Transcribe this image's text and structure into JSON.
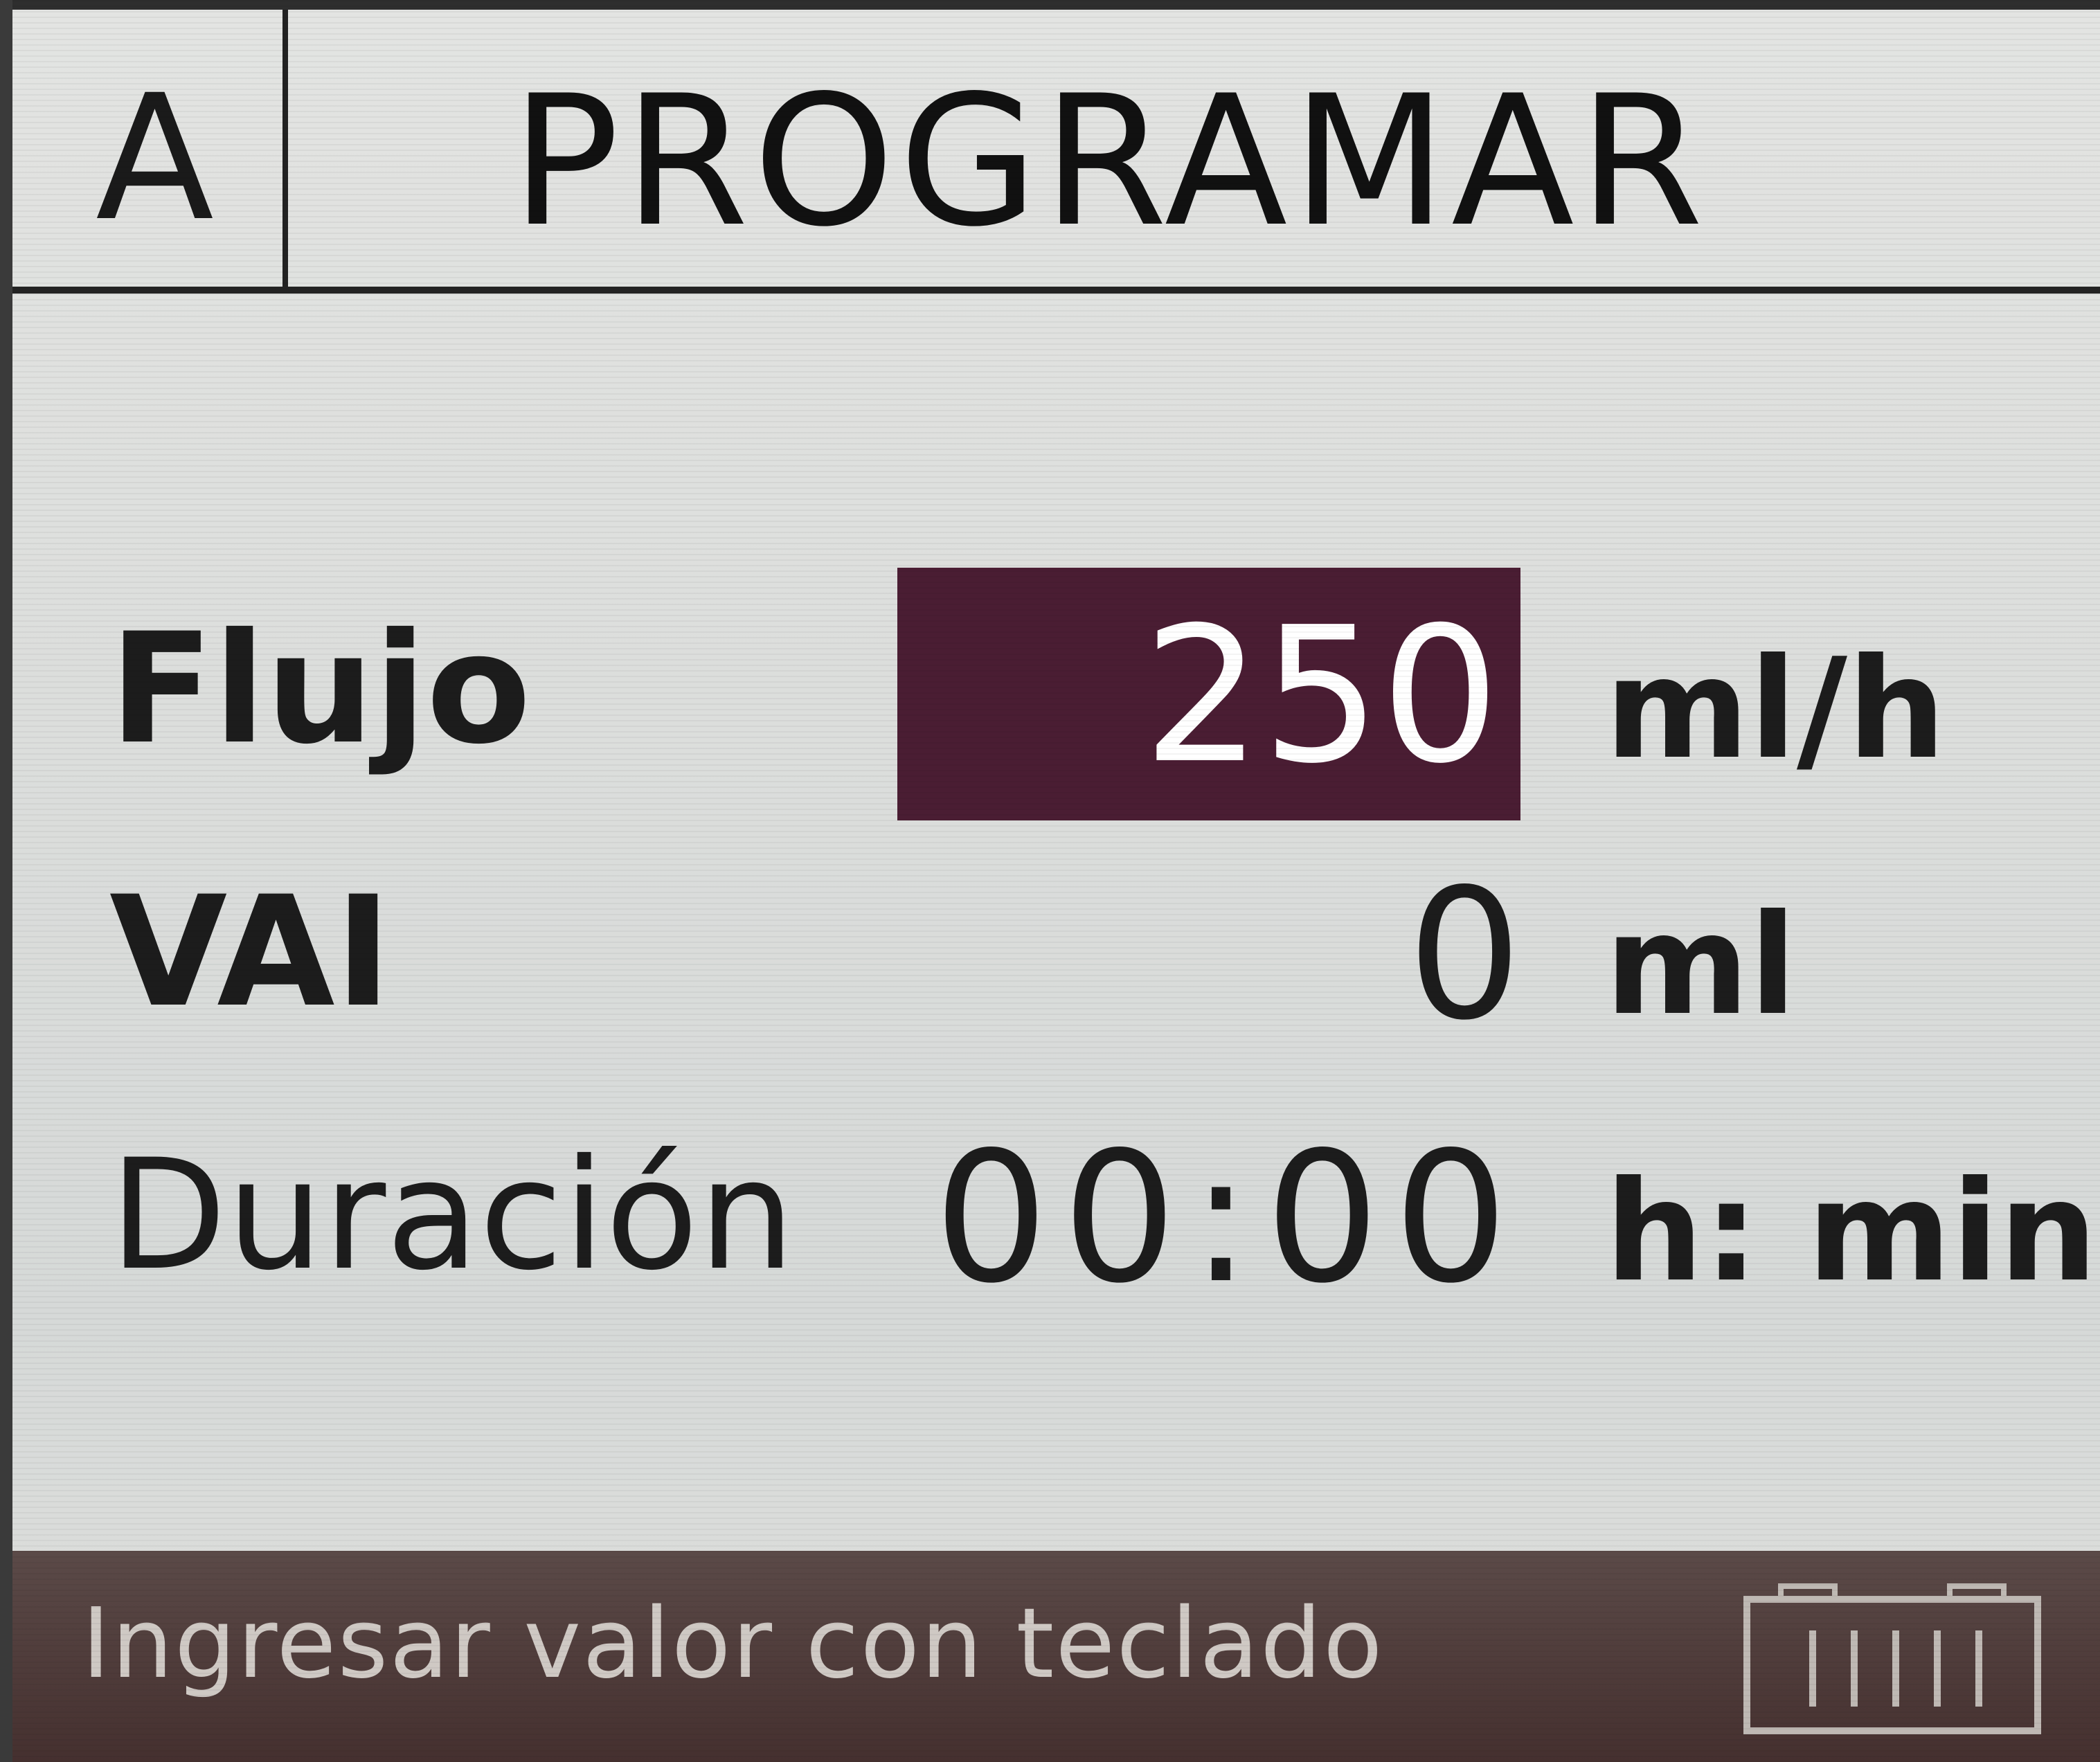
{
  "header": {
    "channel": "A",
    "title": "PROGRAMAR"
  },
  "rows": [
    {
      "label": "Flujo",
      "value": "250",
      "unit": "ml/h",
      "selected": true
    },
    {
      "label": "VAI",
      "value": "0",
      "unit": "ml",
      "selected": false
    },
    {
      "label": "Duración",
      "value": "00:00",
      "unit": "h: min",
      "selected": false
    }
  ],
  "footer": {
    "hint": "Ingresar valor con teclado",
    "battery_icon": "battery-icon",
    "battery_level": 1.0
  },
  "colors": {
    "highlight": "#4a1d33",
    "footer_bg": "#45302f",
    "screen_bg": "#dcdedc"
  }
}
